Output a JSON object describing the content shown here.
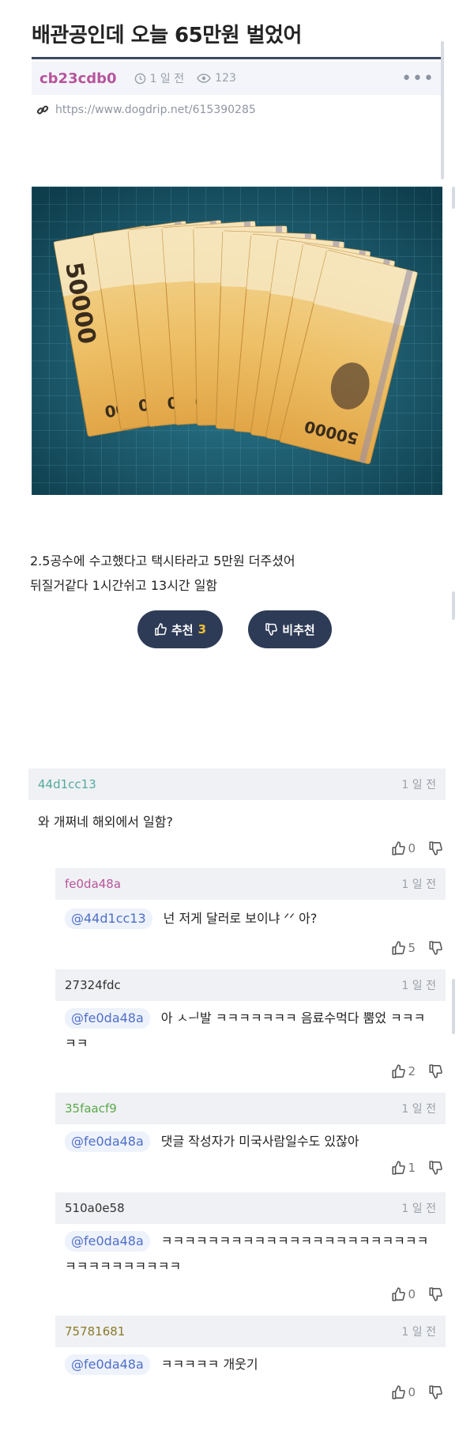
{
  "post": {
    "title": "배관공인데 오늘 65만원 벌었어",
    "author": "cb23cdb0",
    "time": "1 일 전",
    "views": "123",
    "more": "•••",
    "url": "https://www.dogdrip.net/615390285",
    "banknote_denomination": "50000",
    "body": [
      "2.5공수에 수고했다고 택시타라고 5만원 더주셨어",
      "뒤질거같다 1시간쉬고 13시간 일함"
    ],
    "upvote_label": "추천",
    "upvote_count": "3",
    "downvote_label": "비추천"
  },
  "comments": [
    {
      "nick": "44d1cc13",
      "nick_color": "#52a9a0",
      "time": "1 일 전",
      "mention": "",
      "lines": [
        "와 개쩌네 해외에서 일함?"
      ],
      "likes": "0"
    },
    {
      "nick": "fe0da48a",
      "nick_color": "#b7559c",
      "time": "1 일 전",
      "mention": "@44d1cc13",
      "lines": [
        "넌 저게 달러로 보이냐 ᐟᐟ 아?"
      ],
      "likes": "5"
    },
    {
      "nick": "27324fdc",
      "nick_color": "#333333",
      "time": "1 일 전",
      "mention": "@fe0da48a",
      "lines": [
        "아 ㅅᅴ발 ㅋㅋㅋㅋㅋㅋㅋ 음료수먹다 뿜었    ㅋㅋㅋ",
        "ㅋㅋ"
      ],
      "likes": "2"
    },
    {
      "nick": "35faacf9",
      "nick_color": "#5aaa4a",
      "time": "1 일 전",
      "mention": "@fe0da48a",
      "lines": [
        "댓글 작성자가 미국사람일수도 있잖아"
      ],
      "likes": "1"
    },
    {
      "nick": "510a0e58",
      "nick_color": "#333333",
      "time": "1 일 전",
      "mention": "@fe0da48a",
      "lines": [
        "ㅋㅋㅋㅋㅋㅋㅋㅋㅋㅋㅋㅋㅋㅋㅋㅋㅋㅋㅋㅋㅋㅋㅋ",
        "ㅋㅋㅋㅋㅋㅋㅋㅋㅋㅋ"
      ],
      "likes": "0"
    },
    {
      "nick": "75781681",
      "nick_color": "#8a7a2a",
      "time": "1 일 전",
      "mention": "@fe0da48a",
      "lines": [
        "ㅋㅋㅋㅋㅋ 개웃기"
      ],
      "likes": "0"
    }
  ]
}
